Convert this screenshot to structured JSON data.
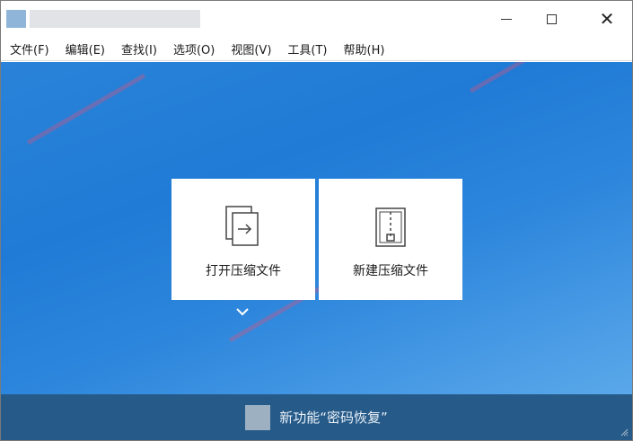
{
  "window": {
    "title": "",
    "icons": {
      "app": "app-icon",
      "minimize": "minimize-icon",
      "maximize": "maximize-icon",
      "close": "close-icon"
    },
    "close_glyph": "✕"
  },
  "menu": {
    "items": [
      {
        "label": "文件(F)"
      },
      {
        "label": "编辑(E)"
      },
      {
        "label": "查找(I)"
      },
      {
        "label": "选项(O)"
      },
      {
        "label": "视图(V)"
      },
      {
        "label": "工具(T)"
      },
      {
        "label": "帮助(H)"
      }
    ]
  },
  "actions": {
    "open_archive": {
      "label": "打开压缩文件",
      "icon": "open-file-icon"
    },
    "new_archive": {
      "label": "新建压缩文件",
      "icon": "zip-archive-icon"
    },
    "expand_icon": "chevron-down-icon"
  },
  "bottom_bar": {
    "feature_text": "新功能“密码恢复”",
    "feature_icon": "feature-thumbnail",
    "grip_icon": "resize-grip-icon"
  },
  "colors": {
    "main_background": "#1f7bd6",
    "bottom_bar": "#265a88",
    "card": "#ffffff"
  }
}
